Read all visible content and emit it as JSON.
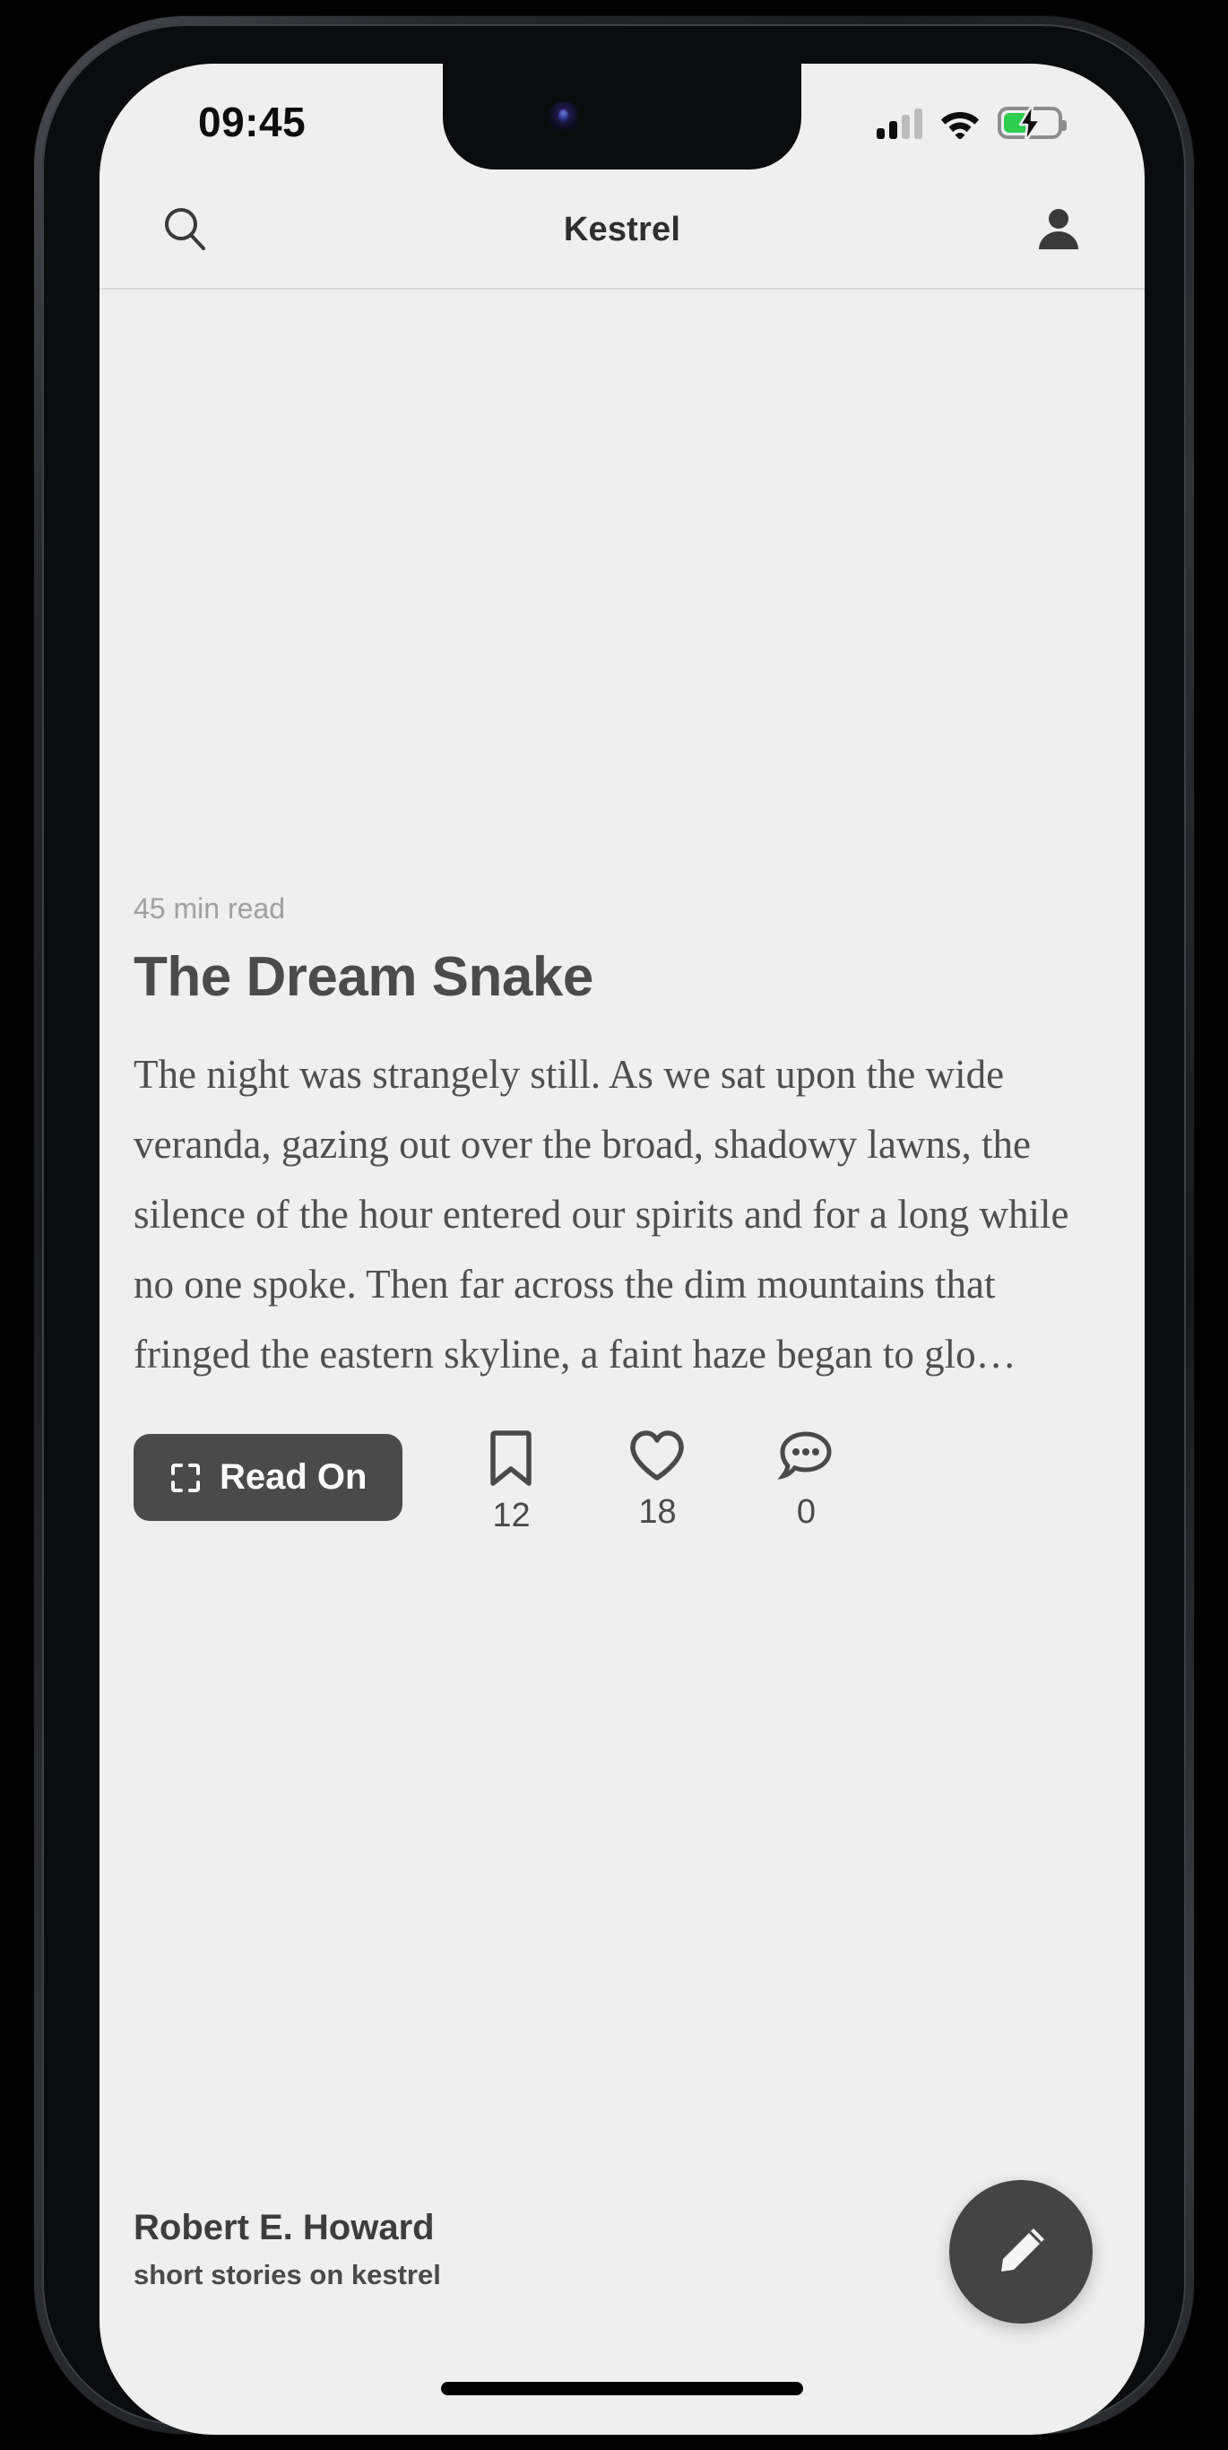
{
  "status_bar": {
    "time": "09:45",
    "signal_icon": "cellular-signal-icon",
    "wifi_icon": "wifi-icon",
    "battery_icon": "battery-charging-icon",
    "battery_level_percent": 42,
    "battery_color": "#2dce4f"
  },
  "navbar": {
    "search_icon": "search-icon",
    "title": "Kestrel",
    "profile_icon": "person-icon"
  },
  "article": {
    "read_time": "45 min read",
    "title": "The Dream Snake",
    "excerpt": "The night was strangely still. As we sat upon the wide veranda, gazing out over the broad, shadowy lawns, the silence of the hour entered our spirits and for a long while no one spoke. Then far across the dim mountains that fringed the eastern skyline, a faint haze began to glo…",
    "read_on_label": "Read On",
    "read_on_icon": "fullscreen-expand-icon",
    "stats": [
      {
        "name": "bookmark",
        "icon": "bookmark-icon",
        "count": "12"
      },
      {
        "name": "like",
        "icon": "heart-icon",
        "count": "18"
      },
      {
        "name": "comment",
        "icon": "comment-bubble-icon",
        "count": "0"
      }
    ]
  },
  "footer": {
    "author": "Robert E. Howard",
    "subtitle": "short stories on kestrel",
    "compose_icon": "pencil-icon"
  },
  "theme": {
    "background": "#efefef",
    "text_primary": "#3d3d3d",
    "text_secondary": "#a0a0a0",
    "accent_dark": "#4a4a4a"
  }
}
